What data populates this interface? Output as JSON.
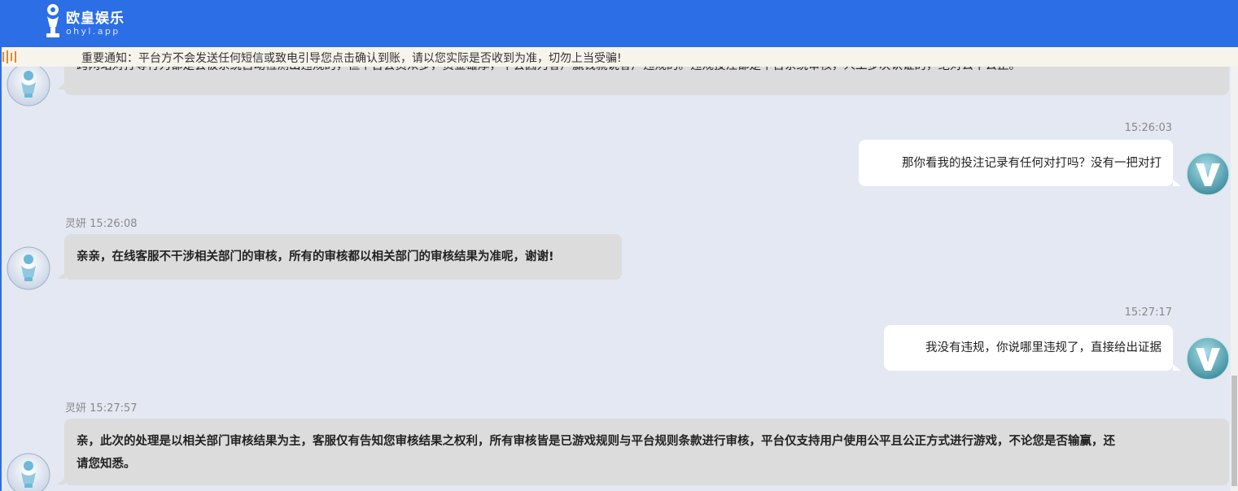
{
  "header": {
    "brand": "欧皇娱乐",
    "domain": "ohyl.app",
    "bg_color": "#2b6ee6"
  },
  "notice": {
    "icon": "broadcast-icon",
    "text": "重要通知：平台方不会发送任何短信或致电引导您点击确认到账，请以您实际是否收到为准，切勿上当受骗!"
  },
  "messages": [
    {
      "sender": "agent",
      "text": "跨网站对打等行为都是会被系统自动检测出违规的，但平台会员众多，资金雄厚，不会因为客户赢钱就说客户违规的。违规投注都是平台系统审核，人工多次认证的，绝对公平公正。"
    },
    {
      "sender": "user",
      "time": "15:26:03",
      "text": "那你看我的投注记录有任何对打吗？没有一把对打"
    },
    {
      "sender": "agent",
      "name": "灵妍",
      "time": "15:26:08",
      "text": "亲亲，在线客服不干涉相关部门的审核，所有的审核都以相关部门的审核结果为准呢，谢谢!"
    },
    {
      "sender": "user",
      "time": "15:27:17",
      "text": "我没有违规，你说哪里违规了，直接给出证据"
    },
    {
      "sender": "agent",
      "name": "灵妍",
      "time": "15:27:57",
      "text_line1": "亲，此次的处理是以相关部门审核结果为主，客服仅有告知您审核结果之权利，所有审核皆是已游戏规则与平台规则条款进行审核，平台仅支持用户使用公平且公正方式进行游戏，不论您是否输赢，还",
      "text_line2": "请您知悉。"
    }
  ],
  "colors": {
    "agent_bubble": "#dcdcdc",
    "user_bubble": "#ffffff",
    "chat_bg": "#e4e8f2"
  }
}
